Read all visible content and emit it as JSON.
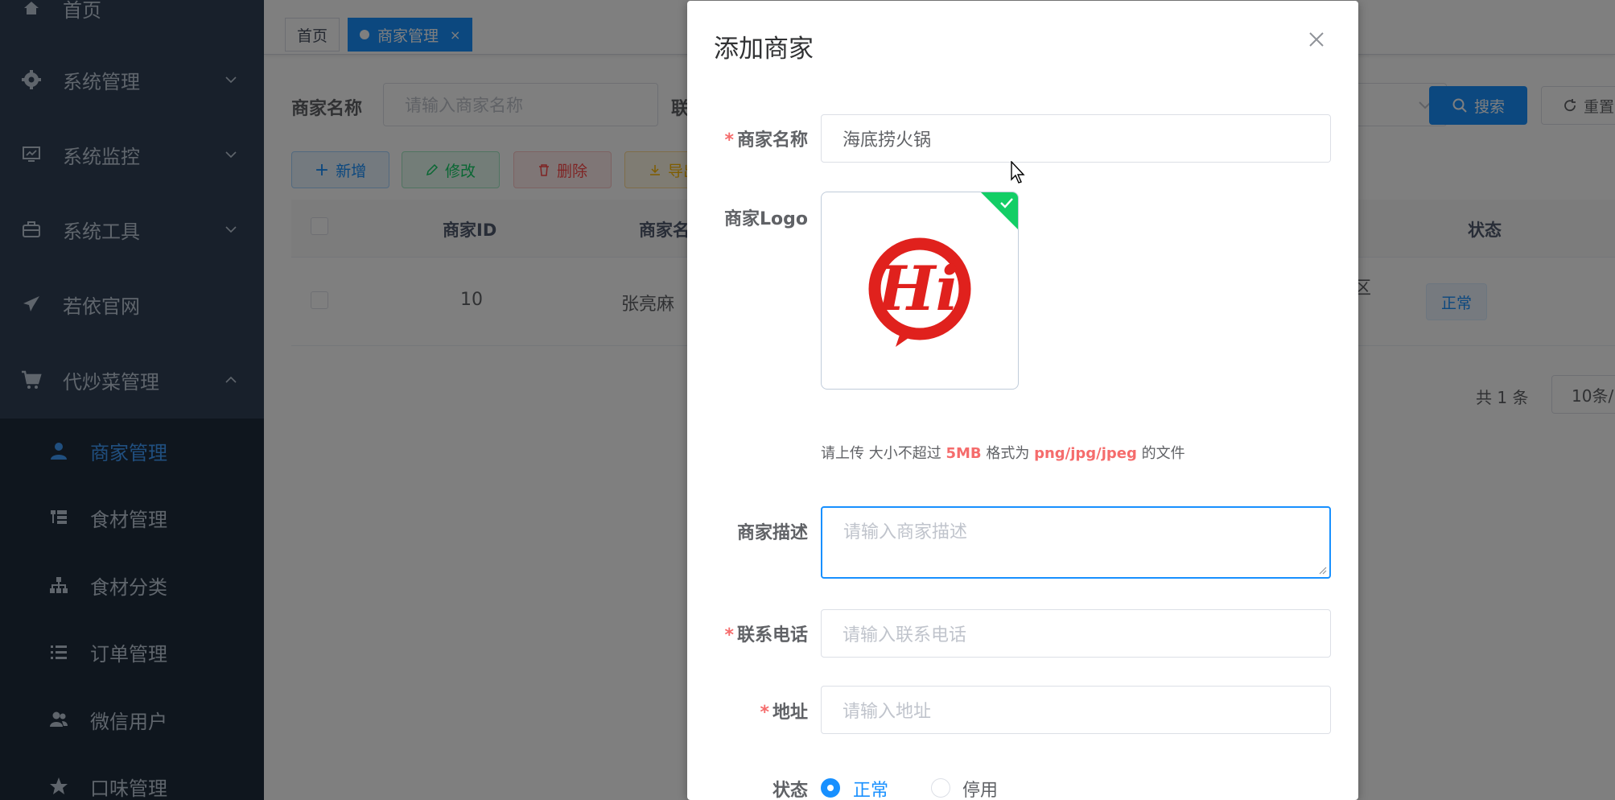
{
  "sidebar": {
    "menu": [
      {
        "label": "首页",
        "icon": "home-icon"
      },
      {
        "label": "系统管理",
        "icon": "gear-icon"
      },
      {
        "label": "系统监控",
        "icon": "monitor-icon"
      },
      {
        "label": "系统工具",
        "icon": "toolbox-icon"
      },
      {
        "label": "若依官网",
        "icon": "paper-plane-icon"
      },
      {
        "label": "代炒菜管理",
        "icon": "shopping-cart-icon"
      }
    ],
    "submenu": [
      {
        "label": "商家管理",
        "icon": "user-icon",
        "active": true
      },
      {
        "label": "食材管理",
        "icon": "list-tree-icon"
      },
      {
        "label": "食材分类",
        "icon": "sitemap-icon"
      },
      {
        "label": "订单管理",
        "icon": "list-icon"
      },
      {
        "label": "微信用户",
        "icon": "users-icon"
      },
      {
        "label": "口味管理",
        "icon": "star-icon"
      }
    ]
  },
  "tags": [
    {
      "label": "首页"
    },
    {
      "label": "商家管理",
      "close": "×"
    }
  ],
  "search": {
    "name_label": "商家名称",
    "name_placeholder": "请输入商家名称",
    "contact_label": "联",
    "search_button": "搜索",
    "reset_button": "重置"
  },
  "toolbar": {
    "add": "新增",
    "edit": "修改",
    "delete": "删除",
    "export": "导出"
  },
  "table": {
    "headers": {
      "id": "商家ID",
      "name": "商家名",
      "status": "状态"
    },
    "rows": [
      {
        "id": "10",
        "name": "张亮麻",
        "address_fragment": "区",
        "status": "正常"
      }
    ]
  },
  "pagination": {
    "total": "共 1 条",
    "page_size": "10条/"
  },
  "dialog": {
    "title": "添加商家",
    "fields": {
      "name": {
        "label": "商家名称",
        "value": "海底捞火锅",
        "required": "*"
      },
      "logo": {
        "label": "商家Logo",
        "logo_text": "Hi"
      },
      "tip": {
        "prefix": "请上传 大小不超过 ",
        "size": "5MB",
        "mid": " 格式为 ",
        "formats": "png/jpg/jpeg",
        "suffix": " 的文件"
      },
      "desc": {
        "label": "商家描述",
        "placeholder": "请输入商家描述"
      },
      "phone": {
        "label": "联系电话",
        "placeholder": "请输入联系电话",
        "required": "*"
      },
      "address": {
        "label": "地址",
        "placeholder": "请输入地址",
        "required": "*"
      },
      "status": {
        "label": "状态",
        "options": [
          "正常",
          "停用"
        ],
        "selected": "正常"
      }
    }
  },
  "colors": {
    "primary": "#1890ff",
    "sidebar_bg": "#304156",
    "submenu_bg": "#1f2d3d",
    "danger": "#f56c6c",
    "success": "#13ce66",
    "logo_red": "#e0211d"
  }
}
